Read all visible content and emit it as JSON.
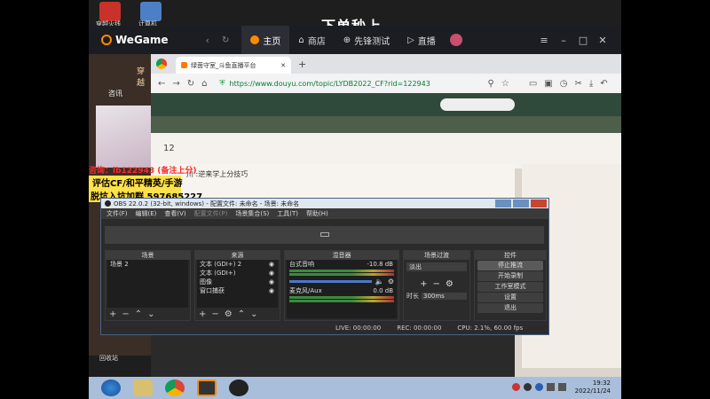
{
  "desktop": {
    "icons": [
      {
        "label": "穿越火线",
        "icon": "crossfire-icon"
      },
      {
        "label": "计算机",
        "icon": "computer-icon"
      }
    ],
    "overlay_title": "下单秒上",
    "side_text": "回收站"
  },
  "wegame": {
    "logo": "WeGame",
    "nav": [
      {
        "label": "主页",
        "icon": "home-face-icon",
        "active": true
      },
      {
        "label": "商店",
        "icon": "store-icon",
        "active": false
      },
      {
        "label": "先锋测试",
        "icon": "test-icon",
        "active": false
      },
      {
        "label": "直播",
        "icon": "live-icon",
        "active": false
      }
    ]
  },
  "left_strip": {
    "top_text": "穿越",
    "sub_text": "咨讯"
  },
  "browser": {
    "tab_title": "绿茵守室_斗鱼直播平台",
    "url": "https://www.douyu.com/topic/LYDB2022_CF?rid=122943"
  },
  "promo": {
    "line1": "咨询：lb122943 (备注上分)",
    "line2": "评估CF/和平精英/手游",
    "line3": "脱坑入坑加群 597685227"
  },
  "stream": {
    "number": "12",
    "title": "川 :逆来学上分技巧"
  },
  "obs": {
    "title": "OBS 22.0.2 (32-bit, windows) - 配置文件: 未命名 - 场景: 未命名",
    "menu": [
      "文件(F)",
      "编辑(E)",
      "查看(V)",
      "配置文件(P)",
      "场景集合(S)",
      "工具(T)",
      "帮助(H)"
    ],
    "docks": {
      "scenes": {
        "title": "场景",
        "items": [
          "场景 2"
        ]
      },
      "sources": {
        "title": "来源",
        "items": [
          "文本 (GDI+) 2",
          "文本 (GDI+)",
          "图像",
          "窗口捕获"
        ]
      },
      "mixer": {
        "title": "混音器",
        "channels": [
          {
            "name": "台式音响",
            "db": "-10.8 dB"
          },
          {
            "name": "麦克风/Aux",
            "db": "0.0 dB"
          }
        ]
      },
      "transitions": {
        "title": "场景过渡",
        "selected": "淡出",
        "duration_label": "时长",
        "duration": "300ms"
      },
      "controls": {
        "title": "控件",
        "buttons": [
          "停止推流",
          "开始录制",
          "工作室模式",
          "设置",
          "退出"
        ]
      }
    },
    "status": {
      "live": "LIVE: 00:00:00",
      "rec": "REC: 00:00:00",
      "cpu": "CPU: 2.1%, 60.00 fps"
    }
  },
  "taskbar": {
    "time": "19:32",
    "date": "2022/11/24"
  }
}
